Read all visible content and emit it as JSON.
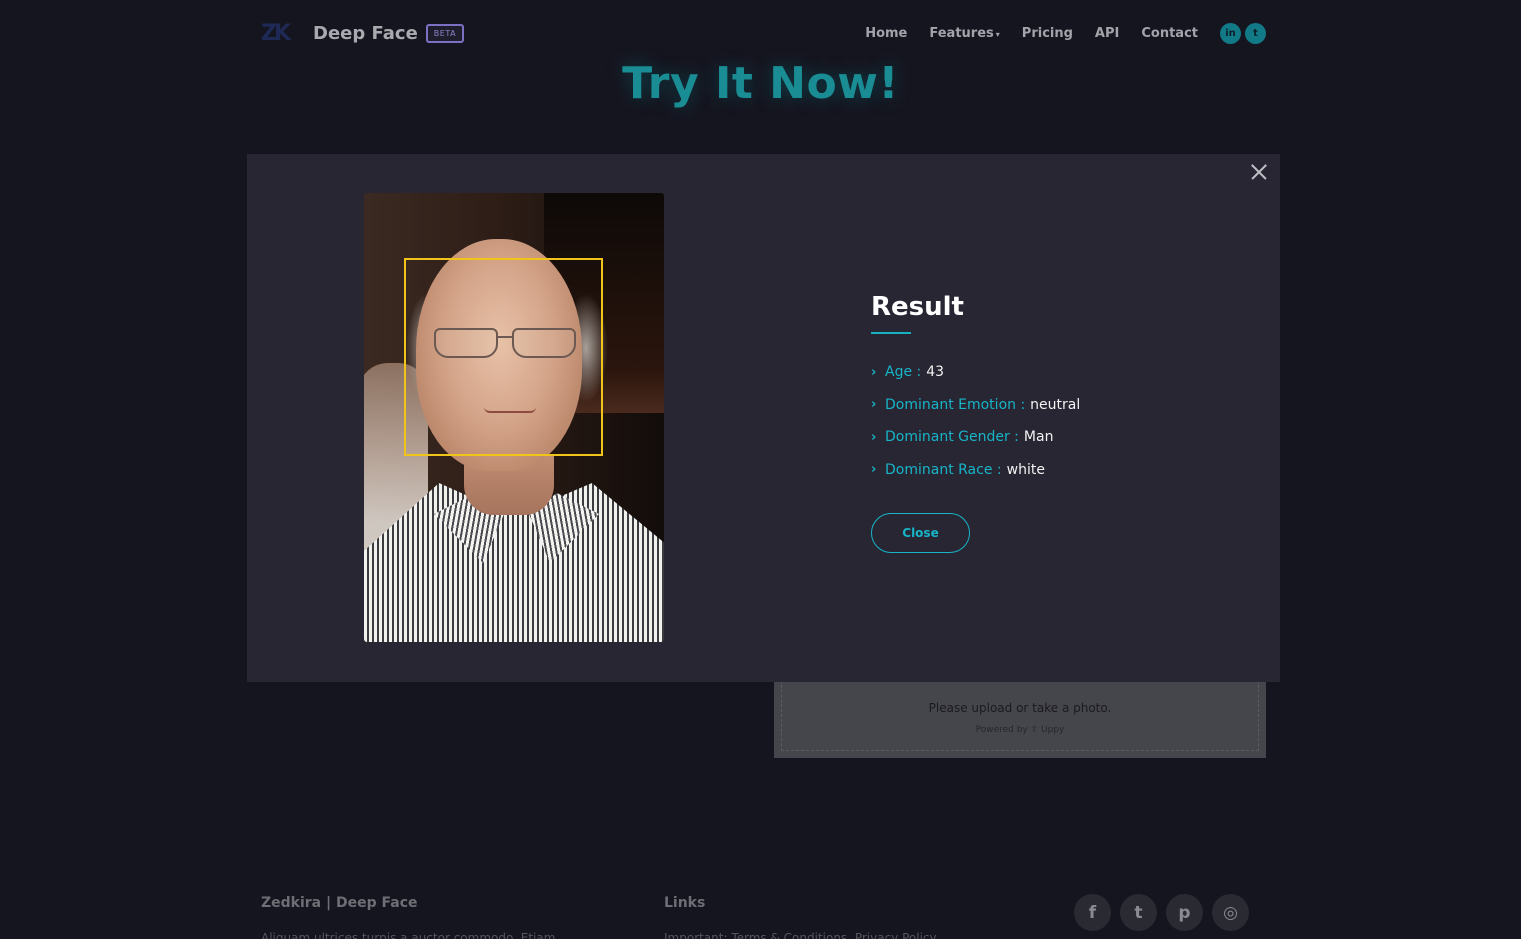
{
  "brand": {
    "name": "Deep Face",
    "badge": "BETA",
    "logo_text": "ZK"
  },
  "nav": {
    "items": [
      "Home",
      "Features",
      "Pricing",
      "API",
      "Contact"
    ],
    "features_caret": "▾",
    "social": [
      "in",
      "t"
    ]
  },
  "hero": {
    "title": "Try It Now!"
  },
  "uploader": {
    "message": "Please upload or take a photo.",
    "powered_by": "Powered by ⇧ Uppy"
  },
  "modal": {
    "result_title": "Result",
    "attributes": [
      {
        "label": "Age :",
        "value": "43"
      },
      {
        "label": "Dominant Emotion :",
        "value": "neutral"
      },
      {
        "label": "Dominant Gender :",
        "value": "Man"
      },
      {
        "label": "Dominant Race :",
        "value": "white"
      }
    ],
    "close_label": "Close"
  },
  "footer": {
    "col1": {
      "heading": "Zedkira | Deep Face",
      "text": "Aliquam ultrices turpis a auctor commodo. Etiam"
    },
    "col2": {
      "heading": "Links",
      "text": "Important: Terms & Conditions, Privacy Policy"
    },
    "social": [
      "f",
      "t",
      "p",
      "◎"
    ]
  },
  "colors": {
    "accent": "#18b4c8",
    "face_box": "#f0c419",
    "modal_bg": "#272632",
    "page_bg": "#15151f"
  }
}
